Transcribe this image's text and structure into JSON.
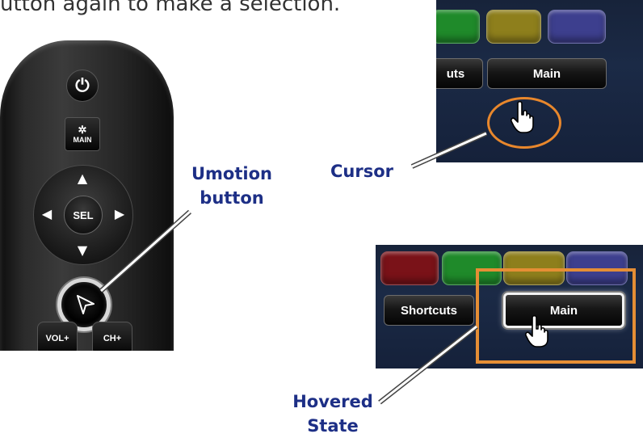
{
  "intro_text": "utton again to make a selection.",
  "callouts": {
    "umotion_line1": "Umotion",
    "umotion_line2": "button",
    "cursor": "Cursor",
    "hovered_line1": "Hovered",
    "hovered_line2": "State"
  },
  "remote": {
    "power_glyph": "⏻",
    "main_label": "MAIN",
    "sel_label": "SEL",
    "vol_label": "VOL+",
    "ch_label": "CH+",
    "arrow_up": "▲",
    "arrow_down": "▼",
    "arrow_left": "◀",
    "arrow_right": "▶"
  },
  "screen_top": {
    "shortcuts_partial": "uts",
    "main_label": "Main"
  },
  "screen_bottom": {
    "shortcuts_label": "Shortcuts",
    "main_label": "Main"
  },
  "colors": {
    "callout_text": "#1d2f86",
    "red_key": "#7a1218",
    "green_key": "#1f8a2a",
    "yellow_key": "#8e7f1c",
    "blue_key": "#3d3f8e",
    "highlight_orange": "#e58e35",
    "panel_bg": "#17233a"
  },
  "icons": [
    "power-icon",
    "main-menu-icon",
    "pointer-arrow-icon",
    "hand-cursor-icon"
  ]
}
